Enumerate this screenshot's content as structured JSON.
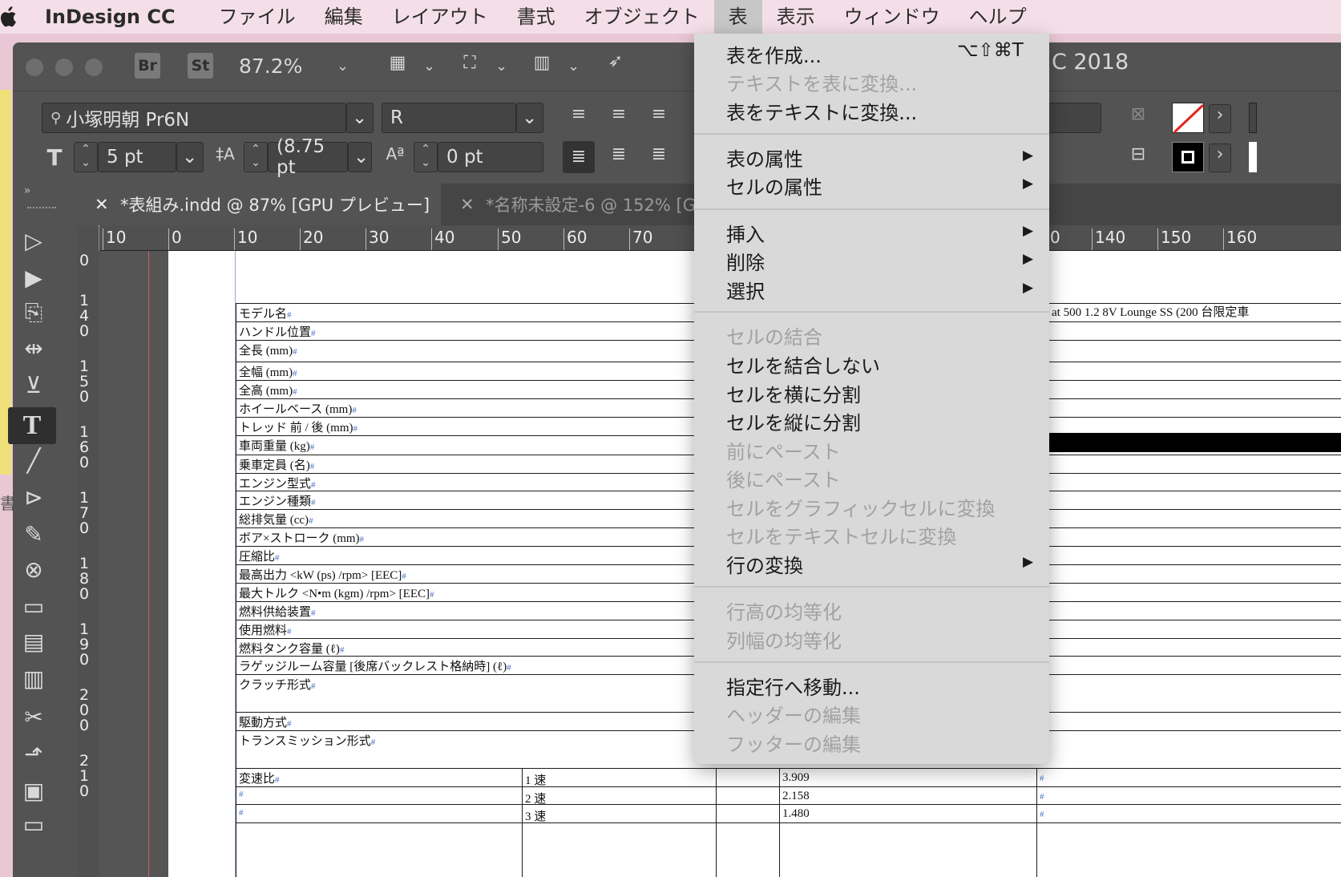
{
  "menubar": {
    "app": "InDesign CC",
    "items": [
      "ファイル",
      "編集",
      "レイアウト",
      "書式",
      "オブジェクト",
      "表",
      "表示",
      "ウィンドウ",
      "ヘルプ"
    ],
    "active": "表"
  },
  "window": {
    "title_fragment": "C 2018"
  },
  "controlbar": {
    "br": "Br",
    "st": "St",
    "zoom": "87.2%"
  },
  "charpanel": {
    "font": "小塚明朝 Pr6N",
    "style": "R",
    "size": "5 pt",
    "leading": "(8.75 pt",
    "tracking": "0 pt"
  },
  "tabs": [
    {
      "label": "*表組み.indd @ 87% [GPU プレビュー]"
    },
    {
      "label": "*名称未設定-6 @ 152% [GP"
    }
  ],
  "ruler": {
    "h": [
      "10",
      "0",
      "10",
      "20",
      "30",
      "40",
      "50",
      "60",
      "70",
      "0",
      "140",
      "150",
      "160"
    ],
    "v": [
      "0",
      "1\n4\n0",
      "1\n5\n0",
      "1\n6\n0",
      "1\n7\n0",
      "1\n8\n0",
      "1\n9\n0",
      "2\n0\n0",
      "2\n1\n0"
    ]
  },
  "table": {
    "rows": [
      "モデル名",
      "ハンドル位置",
      "全長 (mm)",
      "全幅 (mm)",
      "全高 (mm)",
      "ホイールベース (mm)",
      "トレッド 前 / 後 (mm)",
      "車両重量 (kg)",
      "乗車定員 (名)",
      "エンジン型式",
      "エンジン種類",
      "総排気量 (cc)",
      "ボア×ストローク (mm)",
      "圧縮比",
      "最高出力 <kW (ps) /rpm> [EEC]",
      "最大トルク <N•m (kgm) /rpm> [EEC]",
      "燃料供給装置",
      "使用燃料",
      "燃料タンク容量 (ℓ)",
      "ラゲッジルーム容量 [後席バックレスト格納時] (ℓ)",
      "クラッチ形式",
      "駆動方式",
      "トランスミッション形式",
      "変速比"
    ],
    "gears": [
      "1 速",
      "2 速",
      "3 速"
    ],
    "ratios": [
      "3.909",
      "2.158",
      "1.480"
    ],
    "right_peek": "at 500 1.2 8V Lounge SS (200 台限定車"
  },
  "menu": {
    "items": [
      {
        "label": "表を作成...",
        "enabled": true,
        "shortcut": "⌥⇧⌘T"
      },
      {
        "label": "テキストを表に変換...",
        "enabled": false
      },
      {
        "label": "表をテキストに変換...",
        "enabled": true
      },
      {
        "label": "表の属性",
        "enabled": true,
        "submenu": true
      },
      {
        "label": "セルの属性",
        "enabled": true,
        "submenu": true
      },
      {
        "label": "挿入",
        "enabled": true,
        "submenu": true
      },
      {
        "label": "削除",
        "enabled": true,
        "submenu": true
      },
      {
        "label": "選択",
        "enabled": true,
        "submenu": true
      },
      {
        "label": "セルの結合",
        "enabled": false
      },
      {
        "label": "セルを結合しない",
        "enabled": true
      },
      {
        "label": "セルを横に分割",
        "enabled": true
      },
      {
        "label": "セルを縦に分割",
        "enabled": true
      },
      {
        "label": "前にペースト",
        "enabled": false
      },
      {
        "label": "後にペースト",
        "enabled": false
      },
      {
        "label": "セルをグラフィックセルに変換",
        "enabled": false
      },
      {
        "label": "セルをテキストセルに変換",
        "enabled": false
      },
      {
        "label": "行の変換",
        "enabled": true,
        "submenu": true
      },
      {
        "label": "行高の均等化",
        "enabled": false
      },
      {
        "label": "列幅の均等化",
        "enabled": false
      },
      {
        "label": "指定行へ移動...",
        "enabled": true
      },
      {
        "label": "ヘッダーの編集",
        "enabled": false
      },
      {
        "label": "フッターの編集",
        "enabled": false
      }
    ]
  },
  "colors": {
    "menubar": "#f4dfe8",
    "panel": "#535353",
    "menu": "#d9d9d9",
    "disabled": "#a2a2a2"
  }
}
